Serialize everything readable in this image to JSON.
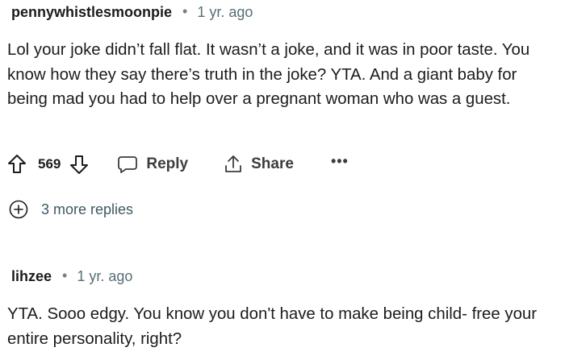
{
  "comments": [
    {
      "author": "pennywhistlesmoonpie",
      "time": "1 yr. ago",
      "body": "Lol your joke didn’t fall flat. It wasn’t a joke, and it was in poor taste. You know how they say there’s truth in the joke? YTA. And a giant baby for being mad you had to help over a pregnant woman who was a guest.",
      "score": "569",
      "reply_label": "Reply",
      "share_label": "Share",
      "more_label": "•••",
      "more_replies_label": "3 more replies"
    },
    {
      "author": "lihzee",
      "time": "1 yr. ago",
      "body": "YTA. Sooo edgy. You know you don't have to make being child- free your entire personality, right?"
    }
  ],
  "icons": {
    "upvote": "upvote-arrow-icon",
    "downvote": "downvote-arrow-icon",
    "reply": "speech-bubble-icon",
    "share": "share-upload-icon",
    "more": "ellipsis-icon",
    "expand": "plus-circle-icon"
  },
  "colors": {
    "text": "#1c1c1c",
    "meta": "#576f76",
    "link": "#3d5963"
  }
}
